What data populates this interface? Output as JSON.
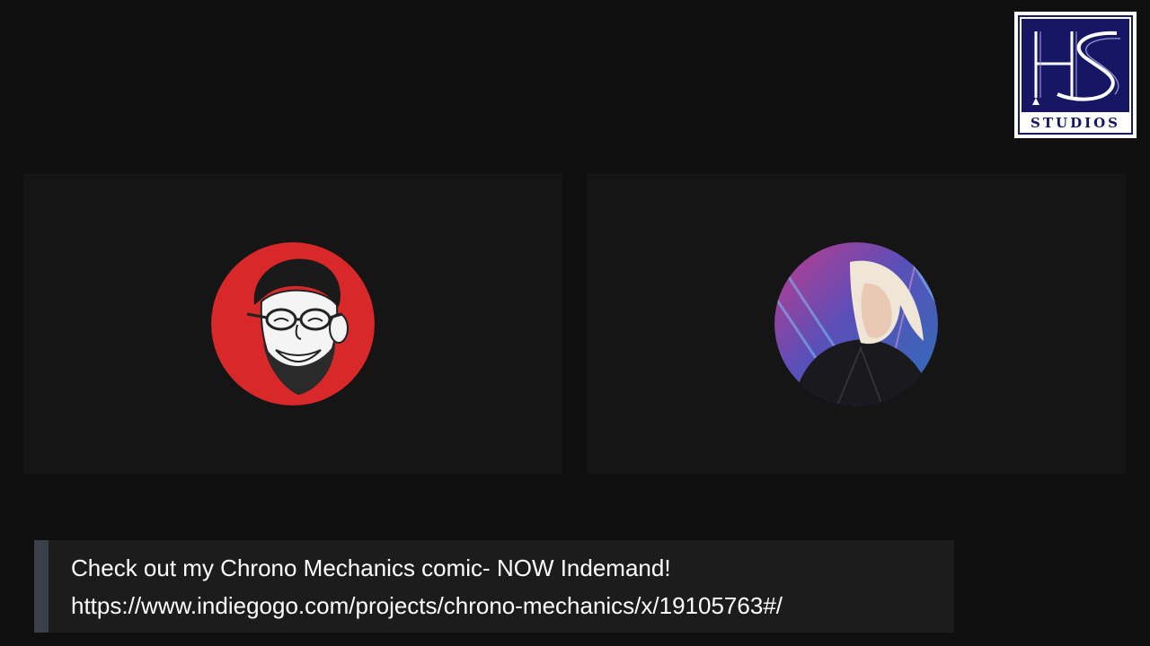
{
  "logo": {
    "text": "STUDIOS",
    "monogram": "HS",
    "colors": {
      "primary": "#161664",
      "background": "#ffffff"
    }
  },
  "participants": [
    {
      "avatar": "cartoon-man-glasses-avatar",
      "accent": "#d8282a"
    },
    {
      "avatar": "blonde-man-leather-jacket-avatar",
      "accent": "#2d6fb8"
    }
  ],
  "banner": {
    "line1": "Check out my Chrono Mechanics comic- NOW Indemand!",
    "line2": "https://www.indiegogo.com/projects/chrono-mechanics/x/19105763#/"
  },
  "colors": {
    "stage": "#0f0f0f",
    "tile": "#151515",
    "banner": "#1c1c1c",
    "banner_accent": "#3a3f4a",
    "text": "#ffffff"
  }
}
